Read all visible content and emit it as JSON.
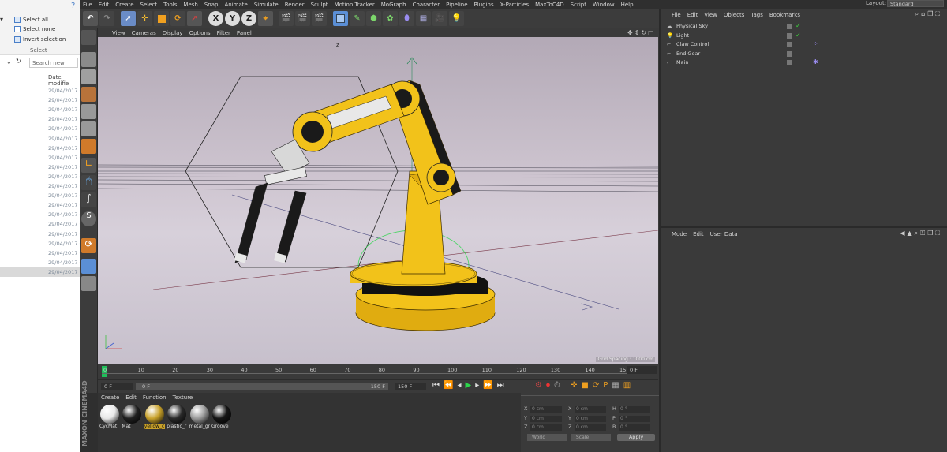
{
  "explorer": {
    "select_all": "Select all",
    "select_none": "Select none",
    "invert_selection": "Invert selection",
    "group_label": "Select",
    "search_placeholder": "Search new",
    "column_header": "Date modifie",
    "rows": [
      "29/04/2017 0",
      "29/04/2017 0",
      "29/04/2017 0",
      "29/04/2017 0",
      "29/04/2017 0",
      "29/04/2017 0",
      "29/04/2017 0",
      "29/04/2017 0",
      "29/04/2017 0",
      "29/04/2017 0",
      "29/04/2017 0",
      "29/04/2017 0",
      "29/04/2017 0",
      "29/04/2017 0",
      "29/04/2017 0",
      "29/04/2017 0",
      "29/04/2017 0",
      "29/04/2017 0",
      "29/04/2017 0",
      "29/04/2017 0"
    ]
  },
  "menubar": [
    "File",
    "Edit",
    "Create",
    "Select",
    "Tools",
    "Mesh",
    "Snap",
    "Animate",
    "Simulate",
    "Render",
    "Sculpt",
    "Motion Tracker",
    "MoGraph",
    "Character",
    "Pipeline",
    "Plugins",
    "X-Particles",
    "MaxToC4D",
    "Script",
    "Window",
    "Help"
  ],
  "layout_label": "Layout:",
  "layout_value": "Standard",
  "toolbar_letters": [
    "X",
    "Y",
    "Z"
  ],
  "viewport_menu": [
    "View",
    "Cameras",
    "Display",
    "Options",
    "Filter",
    "Panel"
  ],
  "grid_spacing": "Grid Spacing : 1000 cm",
  "axis_z_label": "z",
  "timeline_ticks": [
    "0",
    "10",
    "20",
    "30",
    "40",
    "50",
    "60",
    "70",
    "80",
    "90",
    "100",
    "110",
    "120",
    "130",
    "140",
    "15"
  ],
  "frame_end_display": "0 F",
  "playback": {
    "current": "0 F",
    "start": "0 F",
    "range_end": "150 F",
    "end": "150 F"
  },
  "material_menu": [
    "Create",
    "Edit",
    "Function",
    "Texture"
  ],
  "materials": [
    {
      "name": "CycMat",
      "color": "#e8e8e8"
    },
    {
      "name": "Mat",
      "color": "#202020"
    },
    {
      "name": "yellow_c",
      "color": "#c8a12a"
    },
    {
      "name": "plastic_r",
      "color": "#2a2a2a"
    },
    {
      "name": "metal_gr",
      "color": "#9a9a9a"
    },
    {
      "name": "Groove",
      "color": "#151515"
    }
  ],
  "maxon_text": "MAXON CINEMA4D",
  "coordinates": {
    "rows": [
      {
        "a": "X",
        "av": "0 cm",
        "b": "X",
        "bv": "0 cm",
        "c": "H",
        "cv": "0 °"
      },
      {
        "a": "Y",
        "av": "0 cm",
        "b": "Y",
        "bv": "0 cm",
        "c": "P",
        "cv": "0 °"
      },
      {
        "a": "Z",
        "av": "0 cm",
        "b": "Z",
        "bv": "0 cm",
        "c": "B",
        "cv": "0 °"
      }
    ],
    "mode1": "World",
    "mode2": "Scale",
    "apply": "Apply"
  },
  "object_manager": {
    "menu": [
      "File",
      "Edit",
      "View",
      "Objects",
      "Tags",
      "Bookmarks"
    ],
    "objects": [
      "Physical Sky",
      "Light",
      "Claw Control",
      "End Gear",
      "Main"
    ]
  },
  "attribute_manager": {
    "menu": [
      "Mode",
      "Edit",
      "User Data"
    ]
  },
  "colors": {
    "robot_yellow": "#f2c21a",
    "accent_blue": "#5b8fd6"
  }
}
